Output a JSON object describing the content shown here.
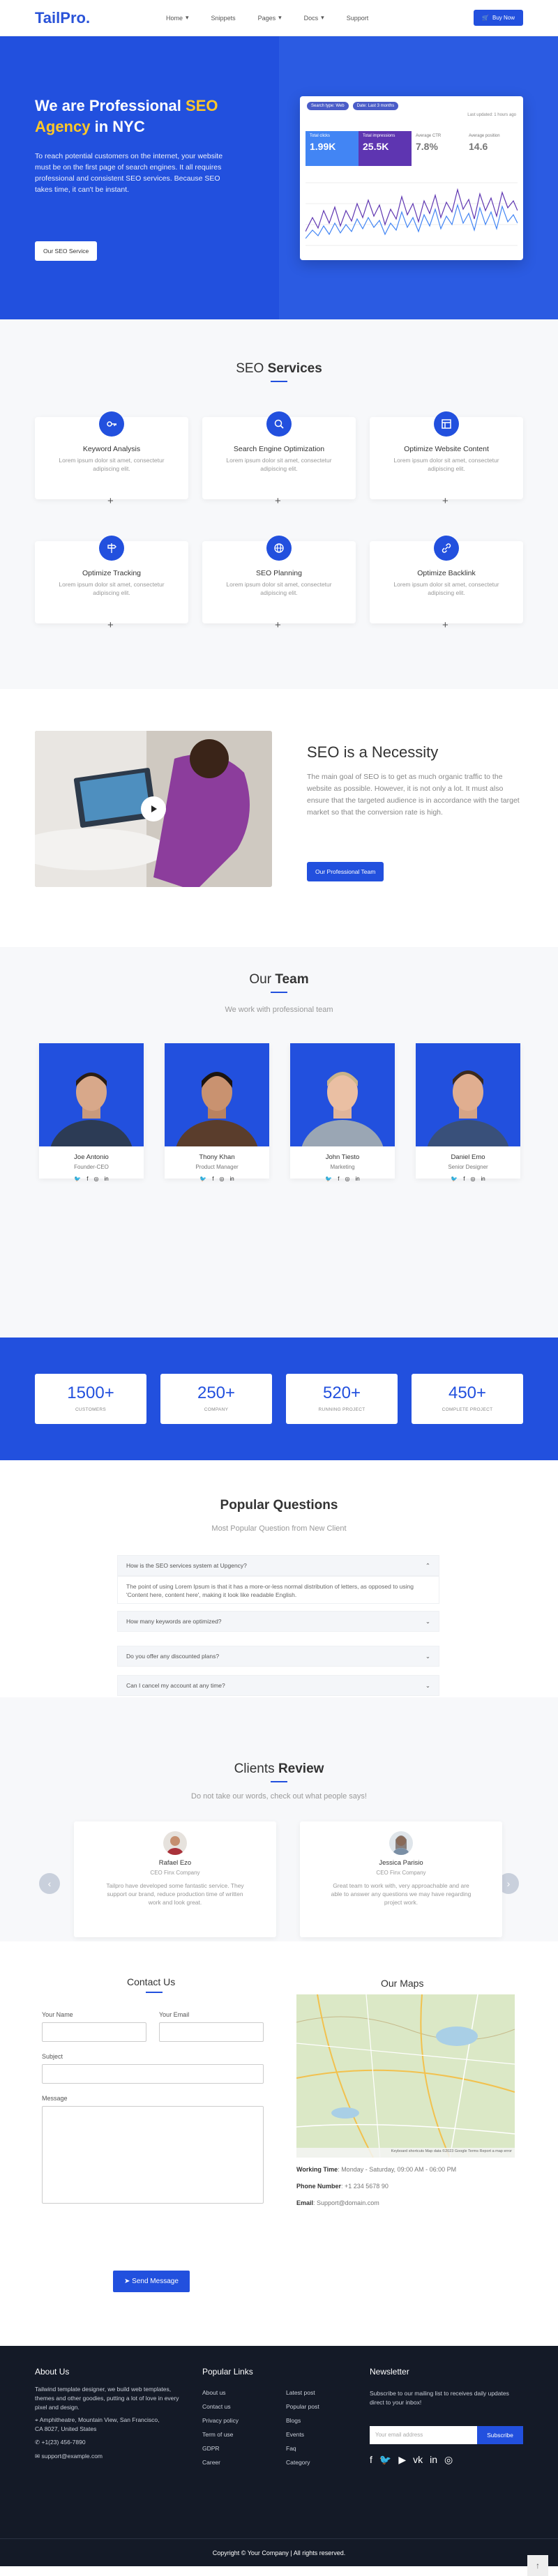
{
  "brand": {
    "name": "TailPro",
    "dot": "."
  },
  "nav": {
    "items": [
      {
        "label": "Home"
      },
      {
        "label": "Snippets"
      },
      {
        "label": "Pages"
      },
      {
        "label": "Docs"
      },
      {
        "label": "Support"
      }
    ],
    "buy_label": "Buy Now"
  },
  "hero": {
    "title_1": "We are Professional ",
    "title_hl": "SEO Agency",
    "title_2": " in NYC",
    "text": "To reach potential customers on the internet, your website must be on the first page of search engines. It all requires professional and consistent SEO services. Because SEO takes time, it can't be instant.",
    "cta": "Our SEO Service"
  },
  "dashboard": {
    "chips": [
      "Search type: Web",
      "Date: Last 3 months"
    ],
    "updated": "Last updated: 1 hours ago",
    "kpis": [
      {
        "label": "Total clicks",
        "value": "1.99K"
      },
      {
        "label": "Total impressions",
        "value": "25.5K"
      },
      {
        "label": "Average CTR",
        "value": "7.8%"
      },
      {
        "label": "Average position",
        "value": "14.6"
      }
    ]
  },
  "services": {
    "title_1": "SEO ",
    "title_2": "Services",
    "items": [
      {
        "title": "Keyword Analysis",
        "text": "Lorem ipsum dolor sit amet, consectetur adipiscing elit.",
        "icon": "key-icon"
      },
      {
        "title": "Search Engine Optimization",
        "text": "Lorem ipsum dolor sit amet, consectetur adipiscing elit.",
        "icon": "search-icon"
      },
      {
        "title": "Optimize Website Content",
        "text": "Lorem ipsum dolor sit amet, consectetur adipiscing elit.",
        "icon": "layout-icon"
      },
      {
        "title": "Optimize Tracking",
        "text": "Lorem ipsum dolor sit amet, consectetur adipiscing elit.",
        "icon": "signpost-icon"
      },
      {
        "title": "SEO Planning",
        "text": "Lorem ipsum dolor sit amet, consectetur adipiscing elit.",
        "icon": "globe-icon"
      },
      {
        "title": "Optimize Backlink",
        "text": "Lorem ipsum dolor sit amet, consectetur adipiscing elit.",
        "icon": "link-icon"
      }
    ],
    "plus": "+"
  },
  "necessity": {
    "title": "SEO is a Necessity",
    "text": "The main goal of SEO is to get as much organic traffic to the website as possible. However, it is not only a lot. It must also ensure that the targeted audience is in accordance with the target market so that the conversion rate is high.",
    "button": "Our Professional Team"
  },
  "team": {
    "title_1": "Our ",
    "title_2": "Team",
    "subtitle": "We work with professional team",
    "members": [
      {
        "name": "Joe Antonio",
        "role": "Founder-CEO"
      },
      {
        "name": "Thony Khan",
        "role": "Product Manager"
      },
      {
        "name": "John Tiesto",
        "role": "Marketing"
      },
      {
        "name": "Daniel Emo",
        "role": "Senior Designer"
      }
    ]
  },
  "stats": [
    {
      "value": "1500+",
      "label": "CUSTOMERS"
    },
    {
      "value": "250+",
      "label": "COMPANY"
    },
    {
      "value": "520+",
      "label": "RUNNING PROJECT"
    },
    {
      "value": "450+",
      "label": "COMPLETE PROJECT"
    }
  ],
  "faq": {
    "title": "Popular Questions",
    "subtitle": "Most Popular Question from New Client",
    "questions": [
      {
        "q": "How is the SEO services system at Upgency?",
        "a": "The point of using Lorem Ipsum is that it has a more-or-less normal distribution of letters, as opposed to using 'Content here, content here', making it look like readable English."
      },
      {
        "q": "How many keywords are optimized?"
      },
      {
        "q": "Do you offer any discounted plans?"
      },
      {
        "q": "Can I cancel my account at any time?"
      }
    ]
  },
  "reviews": {
    "title_1": "Clients ",
    "title_2": "Review",
    "subtitle": "Do not take our words, check out what people says!",
    "items": [
      {
        "name": "Rafael Ezo",
        "company": "CEO Finx Company",
        "text": "Tailpro have developed some fantastic service. They support our brand, reduce production time of written work and look great."
      },
      {
        "name": "Jessica Parisio",
        "company": "CEO Finx Company",
        "text": "Great team to work with, very approachable and are able to answer any questions we may have regarding project work."
      }
    ]
  },
  "contact": {
    "title": "Contact Us",
    "name_label": "Your Name",
    "email_label": "Your Email",
    "subject_label": "Subject",
    "message_label": "Message",
    "send": "Send Message"
  },
  "maps": {
    "title": "Our Maps",
    "hours_label": "Working Time",
    "hours": ": Monday - Saturday, 09:00 AM - 06:00 PM",
    "phone_label": "Phone Number",
    "phone": ": +1 234 5678 90",
    "email_label": "Email",
    "email": ": Support@domain.com",
    "attribution": "Keyboard shortcuts  Map data ©2023 Google  Terms  Report a map error"
  },
  "footer": {
    "about_title": "About Us",
    "about_text": "Tailwind template designer, we build web templates, themes and other goodies, putting a lot of love in every pixel and design.",
    "address": "Amphitheatre, Mountain View, San Francisco, CA 8027, United States",
    "phone": "+1(23) 456-7890",
    "email": "support@example.com",
    "links_title": "Popular Links",
    "links_a": [
      "About us",
      "Contact us",
      "Privacy policy",
      "Term of use",
      "GDPR",
      "Career"
    ],
    "links_b": [
      "Latest post",
      "Popular post",
      "Blogs",
      "Events",
      "Faq",
      "Category"
    ],
    "news_title": "Newsletter",
    "news_text": "Subscribe to our mailing list to receives daily updates direct to your inbox!",
    "news_placeholder": "Your email address",
    "news_btn": "Subscribe",
    "copyright": "Copyright © Your Company | All rights reserved.",
    "top": "↑"
  }
}
